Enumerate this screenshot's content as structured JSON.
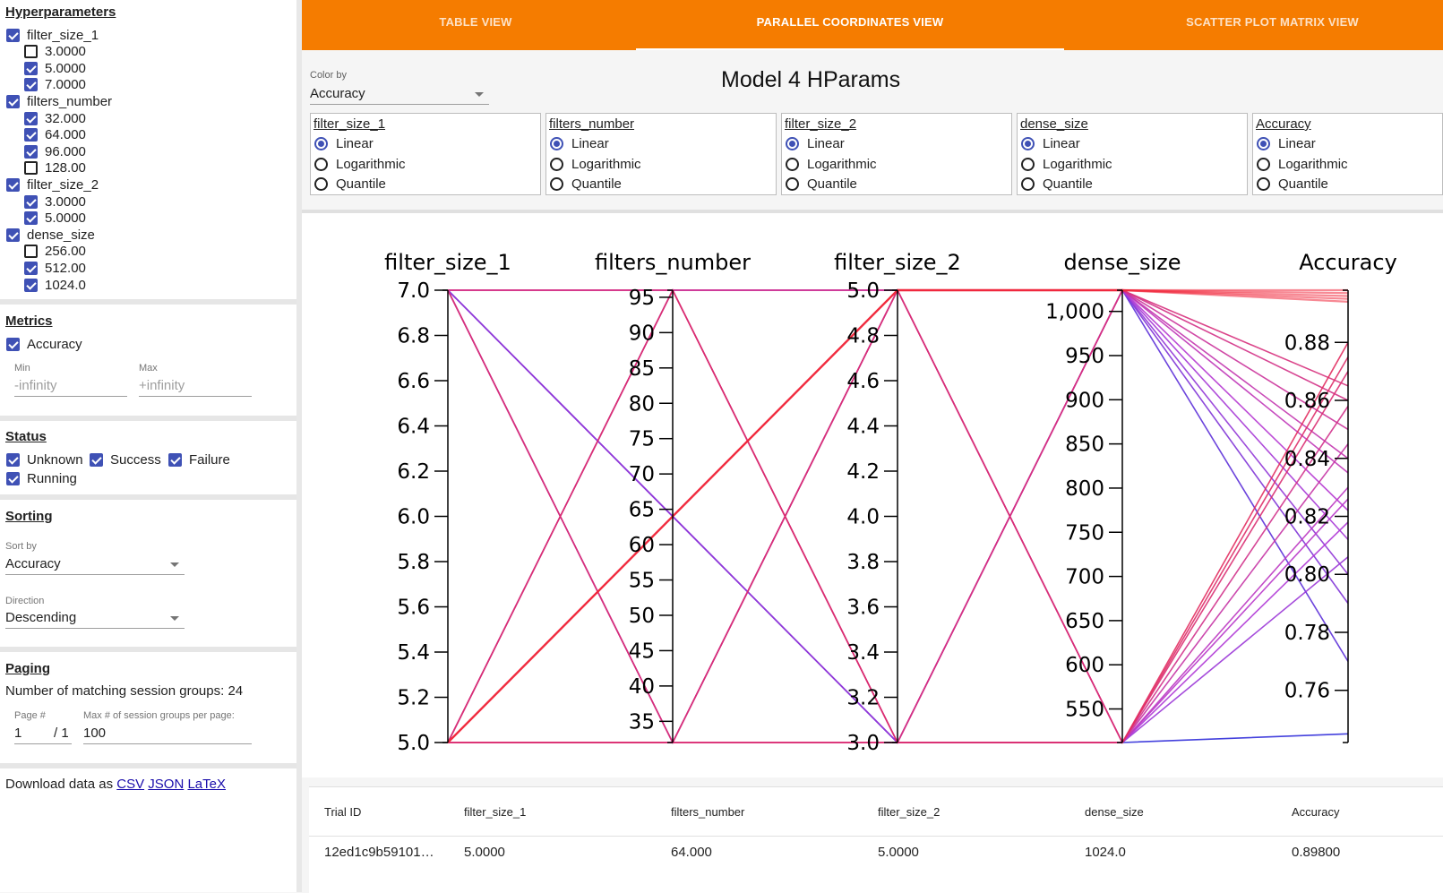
{
  "sidebar": {
    "hyperparameters": {
      "title": "Hyperparameters",
      "groups": [
        {
          "name": "filter_size_1",
          "checked": true,
          "values": [
            {
              "label": "3.0000",
              "checked": false
            },
            {
              "label": "5.0000",
              "checked": true
            },
            {
              "label": "7.0000",
              "checked": true
            }
          ]
        },
        {
          "name": "filters_number",
          "checked": true,
          "values": [
            {
              "label": "32.000",
              "checked": true
            },
            {
              "label": "64.000",
              "checked": true
            },
            {
              "label": "96.000",
              "checked": true
            },
            {
              "label": "128.00",
              "checked": false
            }
          ]
        },
        {
          "name": "filter_size_2",
          "checked": true,
          "values": [
            {
              "label": "3.0000",
              "checked": true
            },
            {
              "label": "5.0000",
              "checked": true
            }
          ]
        },
        {
          "name": "dense_size",
          "checked": true,
          "values": [
            {
              "label": "256.00",
              "checked": false
            },
            {
              "label": "512.00",
              "checked": true
            },
            {
              "label": "1024.0",
              "checked": true
            }
          ]
        }
      ]
    },
    "metrics": {
      "title": "Metrics",
      "item": {
        "label": "Accuracy",
        "checked": true
      },
      "min_label": "Min",
      "min_value": "-infinity",
      "max_label": "Max",
      "max_value": "+infinity"
    },
    "status": {
      "title": "Status",
      "items": [
        {
          "label": "Unknown",
          "checked": true
        },
        {
          "label": "Success",
          "checked": true
        },
        {
          "label": "Failure",
          "checked": true
        },
        {
          "label": "Running",
          "checked": true
        }
      ]
    },
    "sorting": {
      "title": "Sorting",
      "sort_by_label": "Sort by",
      "sort_by_value": "Accuracy",
      "direction_label": "Direction",
      "direction_value": "Descending"
    },
    "paging": {
      "title": "Paging",
      "matching_text": "Number of matching session groups: 24",
      "page_label": "Page #",
      "page_value": "1",
      "page_total": "/ 1",
      "max_label": "Max # of session groups per page:",
      "max_value": "100"
    },
    "download": {
      "prefix": "Download data as",
      "csv": "CSV",
      "json": "JSON",
      "latex": "LaTeX"
    }
  },
  "tabs": [
    {
      "label": "TABLE VIEW",
      "active": false
    },
    {
      "label": "PARALLEL COORDINATES VIEW",
      "active": true
    },
    {
      "label": "SCATTER PLOT MATRIX VIEW",
      "active": false
    }
  ],
  "controls": {
    "color_by_label": "Color by",
    "color_by_value": "Accuracy",
    "scale_options": [
      "Linear",
      "Logarithmic",
      "Quantile"
    ],
    "scale_boxes": [
      {
        "name": "filter_size_1",
        "selected": "Linear"
      },
      {
        "name": "filters_number",
        "selected": "Linear"
      },
      {
        "name": "filter_size_2",
        "selected": "Linear"
      },
      {
        "name": "dense_size",
        "selected": "Linear"
      },
      {
        "name": "Accuracy",
        "selected": "Linear"
      }
    ]
  },
  "chart_data": {
    "type": "parallel_coordinates",
    "title": "Model 4 HParams",
    "axes": [
      {
        "name": "filter_size_1",
        "range": [
          5.0,
          7.0
        ],
        "ticks": [
          "5.0",
          "5.2",
          "5.4",
          "5.6",
          "5.8",
          "6.0",
          "6.2",
          "6.4",
          "6.6",
          "6.8",
          "7.0"
        ],
        "tick_values": [
          5.0,
          5.2,
          5.4,
          5.6,
          5.8,
          6.0,
          6.2,
          6.4,
          6.6,
          6.8,
          7.0
        ]
      },
      {
        "name": "filters_number",
        "range": [
          32,
          96
        ],
        "ticks": [
          "35",
          "40",
          "45",
          "50",
          "55",
          "60",
          "65",
          "70",
          "75",
          "80",
          "85",
          "90",
          "95"
        ],
        "tick_values": [
          35,
          40,
          45,
          50,
          55,
          60,
          65,
          70,
          75,
          80,
          85,
          90,
          95
        ]
      },
      {
        "name": "filter_size_2",
        "range": [
          3.0,
          5.0
        ],
        "ticks": [
          "3.0",
          "3.2",
          "3.4",
          "3.6",
          "3.8",
          "4.0",
          "4.2",
          "4.4",
          "4.6",
          "4.8",
          "5.0"
        ],
        "tick_values": [
          3.0,
          3.2,
          3.4,
          3.6,
          3.8,
          4.0,
          4.2,
          4.4,
          4.6,
          4.8,
          5.0
        ]
      },
      {
        "name": "dense_size",
        "range": [
          512,
          1024
        ],
        "ticks": [
          "550",
          "600",
          "650",
          "700",
          "750",
          "800",
          "850",
          "900",
          "950",
          "1,000"
        ],
        "tick_values": [
          550,
          600,
          650,
          700,
          750,
          800,
          850,
          900,
          950,
          1000
        ]
      },
      {
        "name": "Accuracy",
        "range": [
          0.742,
          0.898
        ],
        "ticks": [
          "0.76",
          "0.78",
          "0.80",
          "0.82",
          "0.84",
          "0.86",
          "0.88"
        ],
        "tick_values": [
          0.76,
          0.78,
          0.8,
          0.82,
          0.84,
          0.86,
          0.88
        ]
      }
    ],
    "color_range": {
      "low": "#2b2bd9",
      "mid": "#b43ad6",
      "high": "#f02a3c"
    },
    "lines": [
      {
        "values": [
          5,
          64,
          5,
          1024,
          0.898
        ],
        "highlight": true
      },
      {
        "values": [
          5,
          64,
          5,
          1024,
          0.897
        ],
        "highlight": true
      },
      {
        "values": [
          5,
          64,
          5,
          1024,
          0.896
        ],
        "highlight": true
      },
      {
        "values": [
          5,
          64,
          5,
          1024,
          0.895
        ],
        "highlight": true
      },
      {
        "values": [
          5,
          64,
          5,
          1024,
          0.894
        ],
        "highlight": true
      },
      {
        "values": [
          5,
          32,
          3,
          512,
          0.88
        ]
      },
      {
        "values": [
          5,
          96,
          3,
          512,
          0.875
        ]
      },
      {
        "values": [
          7,
          32,
          5,
          512,
          0.87
        ]
      },
      {
        "values": [
          7,
          96,
          3,
          1024,
          0.865
        ]
      },
      {
        "values": [
          5,
          32,
          5,
          1024,
          0.86
        ]
      },
      {
        "values": [
          7,
          96,
          5,
          512,
          0.858
        ]
      },
      {
        "values": [
          7,
          32,
          3,
          1024,
          0.85
        ]
      },
      {
        "values": [
          5,
          96,
          5,
          512,
          0.845
        ]
      },
      {
        "values": [
          5,
          32,
          3,
          1024,
          0.84
        ]
      },
      {
        "values": [
          7,
          96,
          5,
          1024,
          0.835
        ]
      },
      {
        "values": [
          5,
          32,
          5,
          512,
          0.83
        ]
      },
      {
        "values": [
          7,
          32,
          3,
          512,
          0.826
        ]
      },
      {
        "values": [
          5,
          96,
          3,
          1024,
          0.822
        ]
      },
      {
        "values": [
          7,
          96,
          3,
          512,
          0.818
        ]
      },
      {
        "values": [
          5,
          32,
          5,
          1024,
          0.812
        ]
      },
      {
        "values": [
          7,
          64,
          3,
          512,
          0.806
        ]
      },
      {
        "values": [
          5,
          96,
          5,
          1024,
          0.8
        ]
      },
      {
        "values": [
          7,
          32,
          5,
          1024,
          0.79
        ]
      },
      {
        "values": [
          7,
          64,
          3,
          1024,
          0.77
        ]
      },
      {
        "values": [
          7,
          64,
          3,
          512,
          0.745
        ]
      }
    ]
  },
  "table": {
    "headers": [
      "Trial ID",
      "filter_size_1",
      "filters_number",
      "filter_size_2",
      "dense_size",
      "Accuracy"
    ],
    "rows": [
      [
        "12ed1c9b59101…",
        "5.0000",
        "64.000",
        "5.0000",
        "1024.0",
        "0.89800"
      ]
    ]
  }
}
